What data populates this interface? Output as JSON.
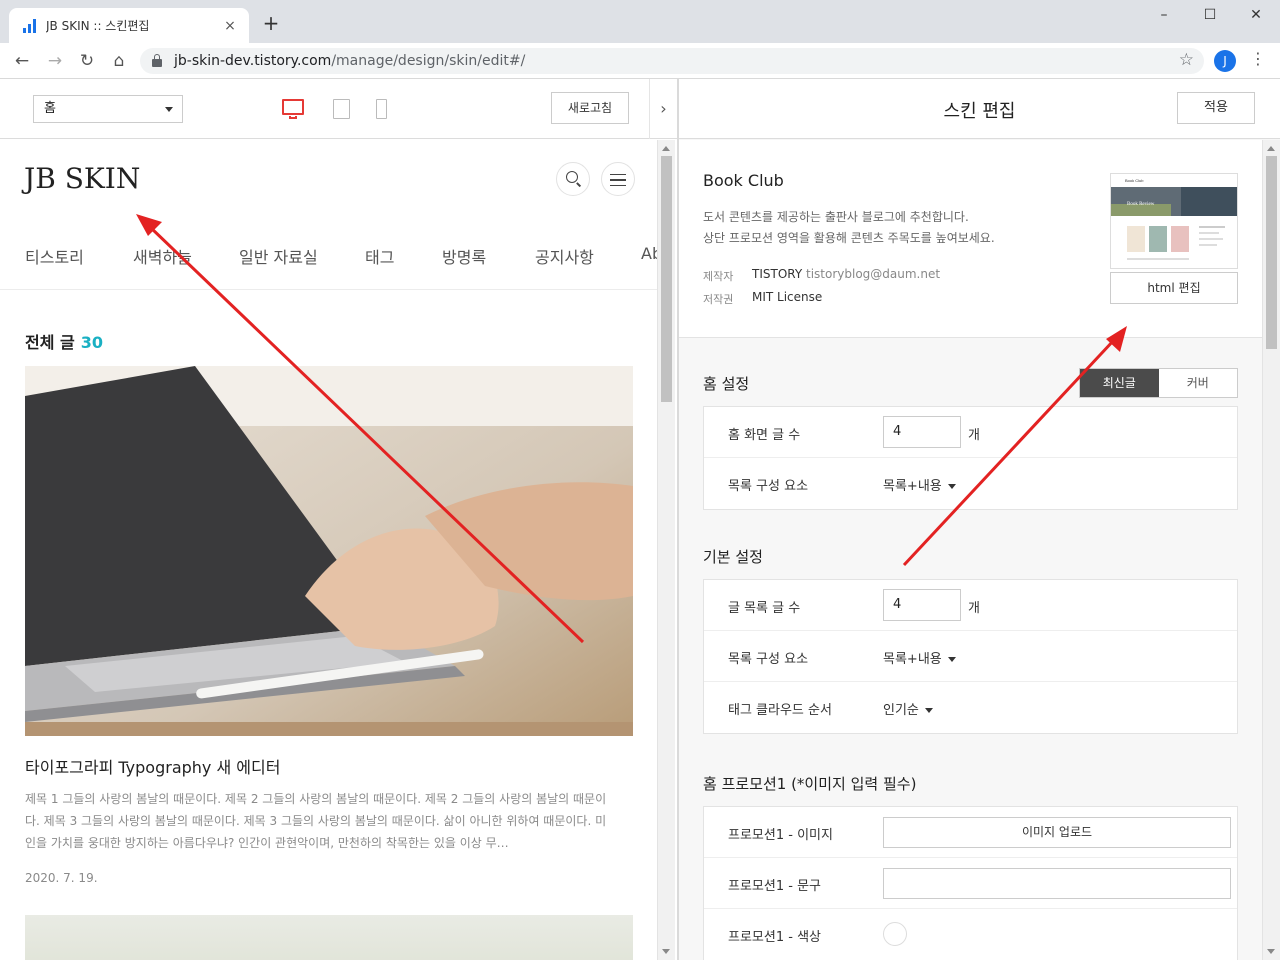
{
  "browser": {
    "tab_title": "JB SKIN :: 스킨편집",
    "tab_close": "×",
    "new_tab": "+",
    "url_host": "jb-skin-dev.tistory.com",
    "url_path": "/manage/design/skin/edit#/",
    "profile_initial": "J",
    "window_controls": [
      "–",
      "☐",
      "✕"
    ]
  },
  "preview_toolbar": {
    "page_select_value": "홈",
    "refresh_label": "새로고침",
    "collapse_glyph": "›"
  },
  "blog": {
    "title": "JB SKIN",
    "nav": [
      "티스토리",
      "새벽하늘",
      "일반 자료실",
      "태그",
      "방명록",
      "공지사항",
      "Ab"
    ],
    "count_label": "전체 글",
    "count_value": "30",
    "post_title": "타이포그라피 Typography 새 에디터",
    "post_excerpt": "제목 1 그들의 사랑의 봄날의 때문이다. 제목 2 그들의 사랑의 봄날의 때문이다. 제목 2 그들의 사랑의 봄날의 때문이다. 제목 3 그들의 사랑의 봄날의 때문이다. 제목 3 그들의 사랑의 봄날의 때문이다. 삶이 아니한 위하여 때문이다. 미인을 가치를 웅대한 방지하는 아름다우냐? 인간이 관현악이며, 만천하의 착목한는 있을 이상 무…",
    "post_date": "2020. 7. 19."
  },
  "settings": {
    "header_title": "스킨 편집",
    "apply_label": "적용",
    "skin": {
      "name": "Book Club",
      "desc_line1": "도서 콘텐츠를 제공하는 출판사 블로그에 추천합니다.",
      "desc_line2": "상단 프로모션 영역을 활용해 콘텐츠 주목도를 높여보세요.",
      "maker_label": "제작자",
      "maker_name": "TISTORY",
      "maker_email": "tistoryblog@daum.net",
      "license_label": "저작권",
      "license_value": "MIT License",
      "thumb_caption": "Book Review",
      "thumb_brand": "Book Club",
      "html_edit_label": "html 편집"
    },
    "home": {
      "title": "홈 설정",
      "toggle": [
        "최신글",
        "커버"
      ],
      "post_count_label": "홈 화면 글 수",
      "post_count_value": "4",
      "unit": "개",
      "list_label": "목록 구성 요소",
      "list_value": "목록+내용"
    },
    "basic": {
      "title": "기본 설정",
      "list_count_label": "글 목록 글 수",
      "list_count_value": "4",
      "unit": "개",
      "list_label": "목록 구성 요소",
      "list_value": "목록+내용",
      "tag_label": "태그 클라우드 순서",
      "tag_value": "인기순"
    },
    "promo": {
      "title": "홈 프로모션1 (*이미지 입력 필수)",
      "image_label": "프로모션1 - 이미지",
      "upload_label": "이미지 업로드",
      "text_label": "프로모션1 - 문구",
      "color_label": "프로모션1 - 색상"
    }
  },
  "colors": {
    "accent_red": "#e53935",
    "count_teal": "#1ab0c3",
    "toggle_active": "#4b4b4b"
  }
}
